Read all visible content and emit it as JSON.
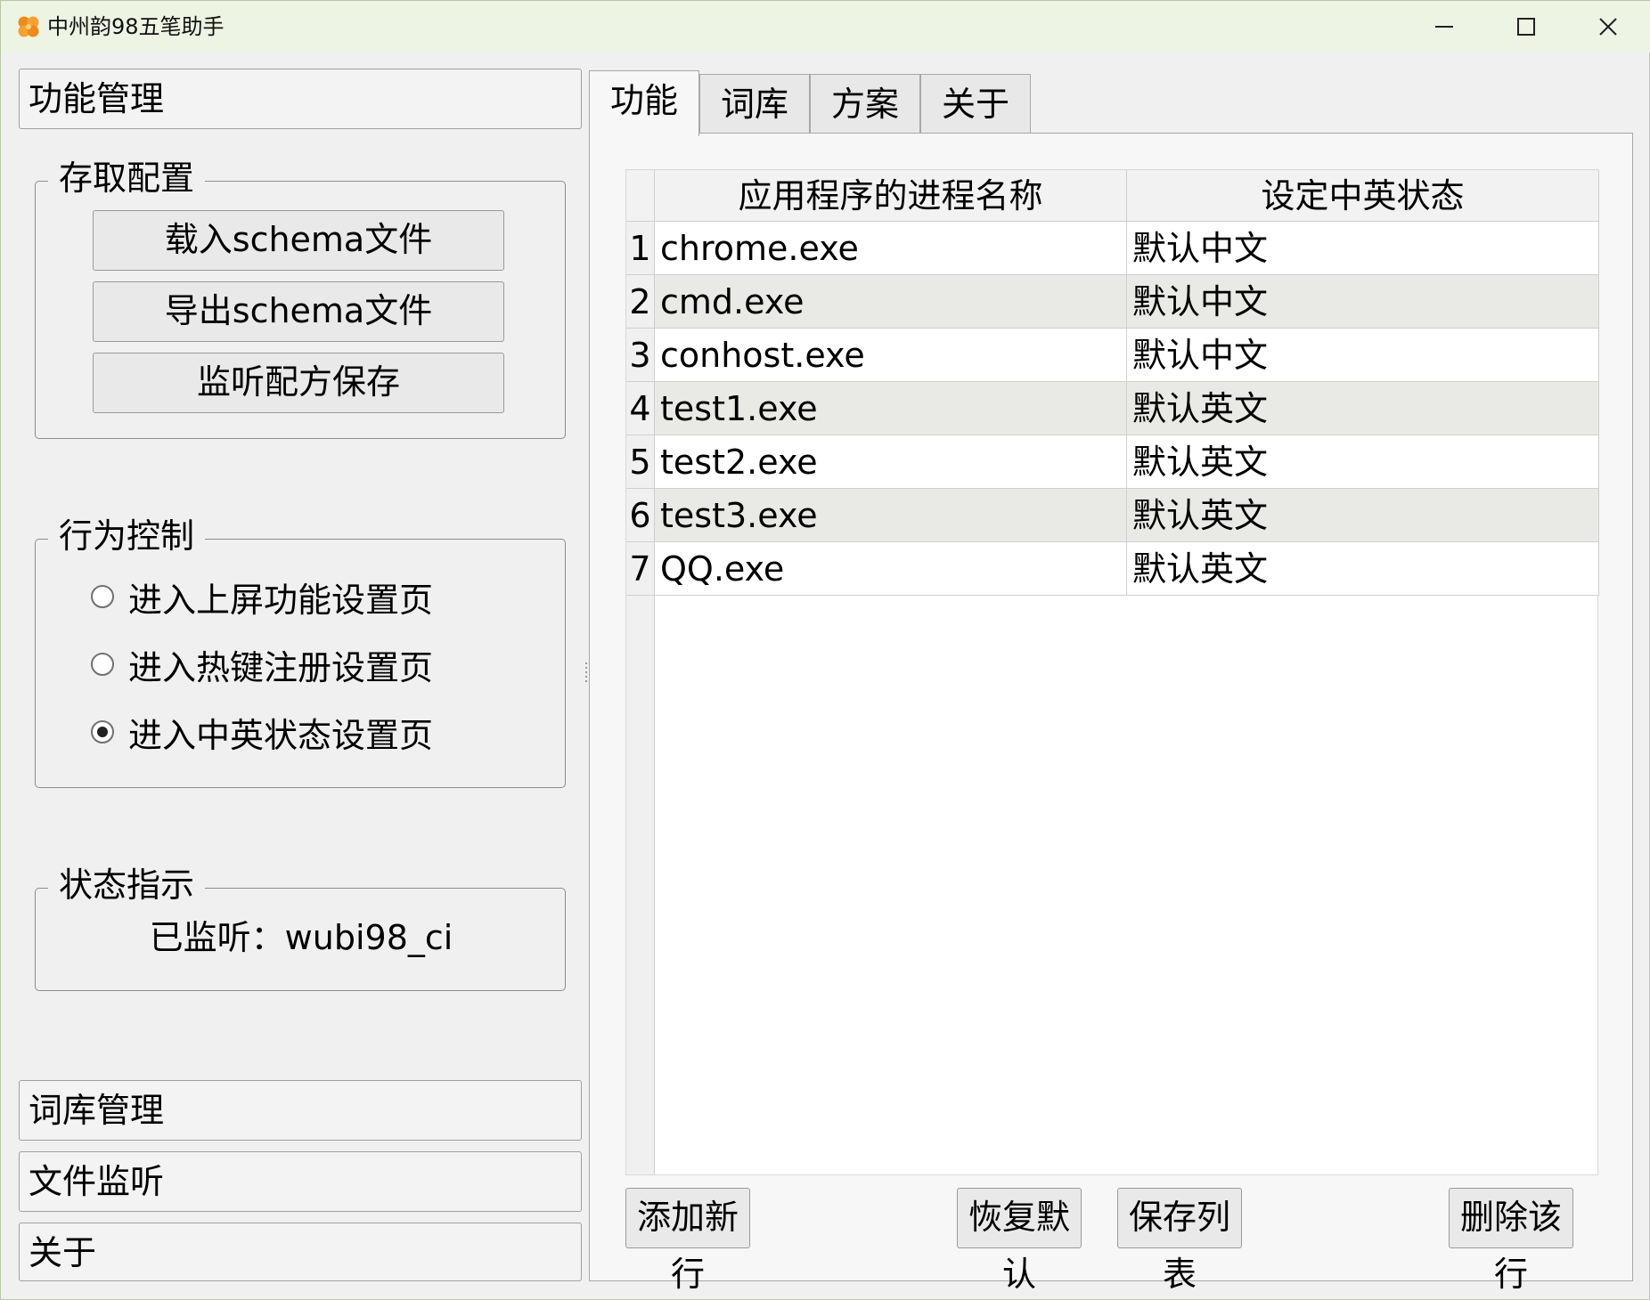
{
  "window": {
    "title": "中州韵98五笔助手",
    "icon": "clover-icon",
    "accent": "#f08a1c"
  },
  "sidebar": {
    "func_header": "功能管理",
    "config_group": {
      "title": "存取配置",
      "buttons": [
        "载入schema文件",
        "导出schema文件",
        "监听配方保存"
      ]
    },
    "behavior_group": {
      "title": "行为控制",
      "options": [
        {
          "label": "进入上屏功能设置页",
          "selected": false
        },
        {
          "label": "进入热键注册设置页",
          "selected": false
        },
        {
          "label": "进入中英状态设置页",
          "selected": true
        }
      ]
    },
    "status_group": {
      "title": "状态指示",
      "text": "已监听：wubi98_ci"
    },
    "bottom_headers": [
      "词库管理",
      "文件监听",
      "关于"
    ]
  },
  "tabs": {
    "items": [
      "功能",
      "词库",
      "方案",
      "关于"
    ],
    "active": 0
  },
  "table": {
    "headers": [
      "应用程序的进程名称",
      "设定中英状态"
    ],
    "rows": [
      {
        "num": "1",
        "name": "chrome.exe",
        "state": "默认中文"
      },
      {
        "num": "2",
        "name": "cmd.exe",
        "state": "默认中文"
      },
      {
        "num": "3",
        "name": "conhost.exe",
        "state": "默认中文"
      },
      {
        "num": "4",
        "name": "test1.exe",
        "state": "默认英文"
      },
      {
        "num": "5",
        "name": "test2.exe",
        "state": "默认英文"
      },
      {
        "num": "6",
        "name": "test3.exe",
        "state": "默认英文"
      },
      {
        "num": "7",
        "name": "QQ.exe",
        "state": "默认英文"
      }
    ]
  },
  "actions": {
    "add": "添加新行",
    "restore": "恢复默认",
    "save": "保存列表",
    "delete": "删除该行"
  }
}
